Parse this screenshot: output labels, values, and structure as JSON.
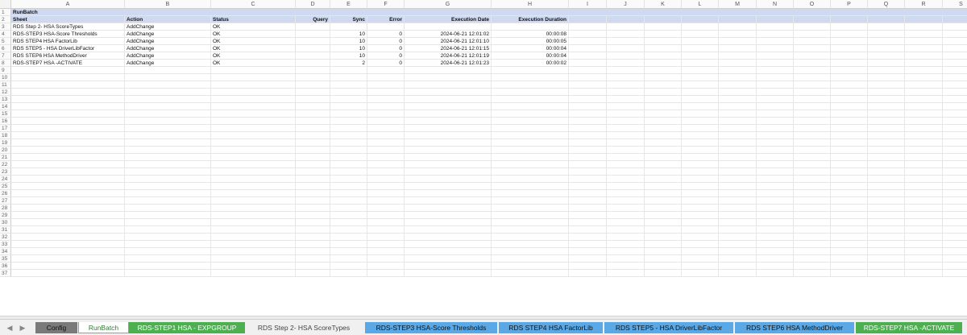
{
  "columns": [
    "A",
    "B",
    "C",
    "D",
    "E",
    "F",
    "G",
    "H",
    "I",
    "J",
    "K",
    "L",
    "M",
    "N",
    "O",
    "P",
    "Q",
    "R",
    "S",
    "T",
    "U"
  ],
  "row_numbers": [
    "1",
    "2",
    "3",
    "4",
    "5",
    "6",
    "7",
    "8",
    "9",
    "10",
    "11",
    "12",
    "13",
    "14",
    "15",
    "16",
    "17",
    "18",
    "19",
    "20",
    "21",
    "22",
    "23",
    "24",
    "25",
    "26",
    "27",
    "28",
    "29",
    "30",
    "31",
    "32",
    "33",
    "34",
    "35",
    "36",
    "37"
  ],
  "title": "RunBatch",
  "headers": {
    "sheet": "Sheet",
    "action": "Action",
    "status": "Status",
    "query": "Query",
    "sync": "Sync",
    "error": "Error",
    "exec_date": "Execution Date",
    "exec_duration": "Execution Duration"
  },
  "rows": [
    {
      "sheet": "RDS Step 2- HSA ScoreTypes",
      "action": "AddChange",
      "status": "OK",
      "query": "",
      "sync": "",
      "error": "",
      "date": "",
      "duration": ""
    },
    {
      "sheet": "RDS-STEP3 HSA-Score Thresholds",
      "action": "AddChange",
      "status": "OK",
      "query": "",
      "sync": "10",
      "error": "0",
      "date": "2024-06-21 12:01:02",
      "duration": "00:00:08"
    },
    {
      "sheet": "RDS STEP4 HSA FactorLib",
      "action": "AddChange",
      "status": "OK",
      "query": "",
      "sync": "10",
      "error": "0",
      "date": "2024-06-21 12:01:10",
      "duration": "00:00:05"
    },
    {
      "sheet": "RDS STEP5 - HSA DriverLibFactor",
      "action": "AddChange",
      "status": "OK",
      "query": "",
      "sync": "10",
      "error": "0",
      "date": "2024-06-21 12:01:15",
      "duration": "00:00:04"
    },
    {
      "sheet": "RDS STEP6 HSA MethodDriver",
      "action": "AddChange",
      "status": "OK",
      "query": "",
      "sync": "10",
      "error": "0",
      "date": "2024-06-21 12:01:19",
      "duration": "00:00:04"
    },
    {
      "sheet": "RDS-STEP7 HSA -ACTIVATE",
      "action": "AddChange",
      "status": "OK",
      "query": "",
      "sync": "2",
      "error": "0",
      "date": "2024-06-21 12:01:23",
      "duration": "00:00:02"
    }
  ],
  "tabs": [
    {
      "label": "Config",
      "bg": "#7a7a7a",
      "fg": "#111111",
      "active": false
    },
    {
      "label": "RunBatch",
      "bg": "#ffffff",
      "fg": "#2e7d32",
      "active": true
    },
    {
      "label": "RDS-STEP1 HSA - EXPGROUP",
      "bg": "#4caf50",
      "fg": "#ffffff",
      "active": false
    },
    {
      "label": "RDS Step 2- HSA ScoreTypes",
      "bg": "#f0f0f0",
      "fg": "#444444",
      "active": false
    },
    {
      "label": "RDS-STEP3 HSA-Score Thresholds",
      "bg": "#5aa9e6",
      "fg": "#111111",
      "active": false
    },
    {
      "label": "RDS STEP4 HSA FactorLib",
      "bg": "#5aa9e6",
      "fg": "#111111",
      "active": false
    },
    {
      "label": "RDS STEP5 - HSA DriverLibFactor",
      "bg": "#5aa9e6",
      "fg": "#111111",
      "active": false
    },
    {
      "label": "RDS STEP6 HSA MethodDriver",
      "bg": "#5aa9e6",
      "fg": "#111111",
      "active": false
    },
    {
      "label": "RDS-STEP7 HSA -ACTIVATE",
      "bg": "#4caf50",
      "fg": "#ffffff",
      "active": false
    }
  ],
  "colors": {
    "header_row": "#cfdaf0",
    "grid": "#e6e6e6"
  }
}
